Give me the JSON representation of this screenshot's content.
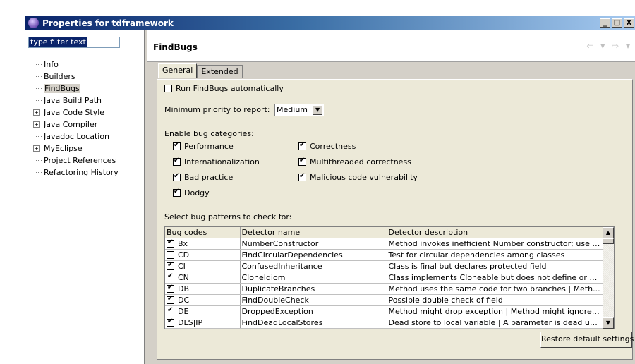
{
  "window": {
    "title": "Properties for tdframework",
    "min_label": "_",
    "max_label": "□",
    "close_label": "X"
  },
  "sidebar": {
    "filter_text": "type filter text",
    "items": [
      {
        "label": "Info",
        "expander": ""
      },
      {
        "label": "Builders",
        "expander": ""
      },
      {
        "label": "FindBugs",
        "expander": "",
        "selected": true
      },
      {
        "label": "Java Build Path",
        "expander": ""
      },
      {
        "label": "Java Code Style",
        "expander": "+"
      },
      {
        "label": "Java Compiler",
        "expander": "+"
      },
      {
        "label": "Javadoc Location",
        "expander": ""
      },
      {
        "label": "MyEclipse",
        "expander": "+"
      },
      {
        "label": "Project References",
        "expander": ""
      },
      {
        "label": "Refactoring History",
        "expander": ""
      }
    ]
  },
  "page": {
    "title": "FindBugs",
    "nav_arrows": "⇦ ▾ ⇨ ▾"
  },
  "tabs": [
    {
      "label": "General",
      "active": true
    },
    {
      "label": "Extended",
      "active": false
    }
  ],
  "general": {
    "run_auto_label": "Run FindBugs automatically",
    "run_auto_checked": false,
    "min_priority_label": "Minimum priority to report:",
    "min_priority_value": "Medium",
    "enable_categories_label": "Enable bug categories:",
    "categories": [
      {
        "label": "Performance",
        "checked": true
      },
      {
        "label": "Correctness",
        "checked": true
      },
      {
        "label": "Internationalization",
        "checked": true
      },
      {
        "label": "Multithreaded correctness",
        "checked": true
      },
      {
        "label": "Bad practice",
        "checked": true
      },
      {
        "label": "Malicious code vulnerability",
        "checked": true
      },
      {
        "label": "Dodgy",
        "checked": true
      }
    ],
    "select_patterns_label": "Select bug patterns to check for:",
    "columns": [
      "Bug codes",
      "Detector name",
      "Detector description"
    ],
    "rows": [
      {
        "code": "Bx",
        "detector": "NumberConstructor",
        "description": "Method invokes inefficient Number constructor; use s...",
        "checked": true
      },
      {
        "code": "CD",
        "detector": "FindCircularDependencies",
        "description": "Test for circular dependencies among classes",
        "checked": false
      },
      {
        "code": "CI",
        "detector": "ConfusedInheritance",
        "description": "Class is final but declares protected field",
        "checked": true
      },
      {
        "code": "CN",
        "detector": "CloneIdiom",
        "description": "Class implements Cloneable but does not define or us...",
        "checked": true
      },
      {
        "code": "DB",
        "detector": "DuplicateBranches",
        "description": "Method uses the same code for two branches | Meth...",
        "checked": true
      },
      {
        "code": "DC",
        "detector": "FindDoubleCheck",
        "description": "Possible double check of field",
        "checked": true
      },
      {
        "code": "DE",
        "detector": "DroppedException",
        "description": "Method might drop exception | Method might ignore ...",
        "checked": true
      },
      {
        "code": "DLS|IP",
        "detector": "FindDeadLocalStores",
        "description": "Dead store to local variable | A parameter is dead up...",
        "checked": true
      }
    ],
    "restore_label": "Restore default settings"
  }
}
